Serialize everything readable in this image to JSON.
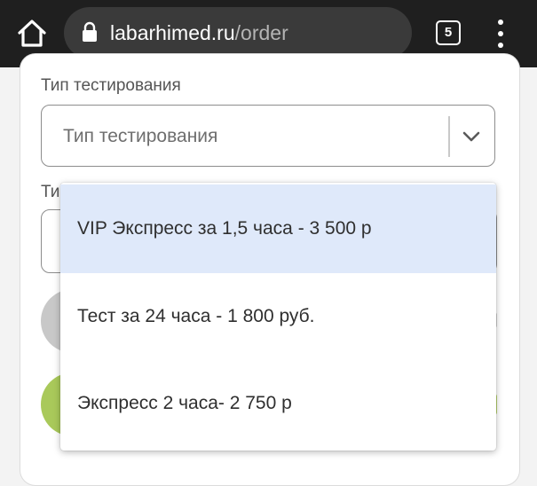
{
  "browser": {
    "url_domain": "labarhimed.ru",
    "url_path": "/order",
    "tab_count": "5"
  },
  "form": {
    "test_type_label": "Тип тестирования",
    "test_type_placeholder": "Тип тестирования",
    "second_label_fragment": "Ти"
  },
  "dropdown": {
    "options": [
      {
        "label": "VIP Экспресс за 1,5 часа - 3 500 р",
        "highlighted": true
      },
      {
        "label": "Тест за 24 часа - 1 800 руб.",
        "highlighted": false
      },
      {
        "label": "Экспресс 2 часа- 2 750 р",
        "highlighted": false
      }
    ]
  },
  "colors": {
    "chrome_bg": "#1f1f1f",
    "highlight": "#dfe9fa",
    "accent_green": "#a9c95a"
  }
}
